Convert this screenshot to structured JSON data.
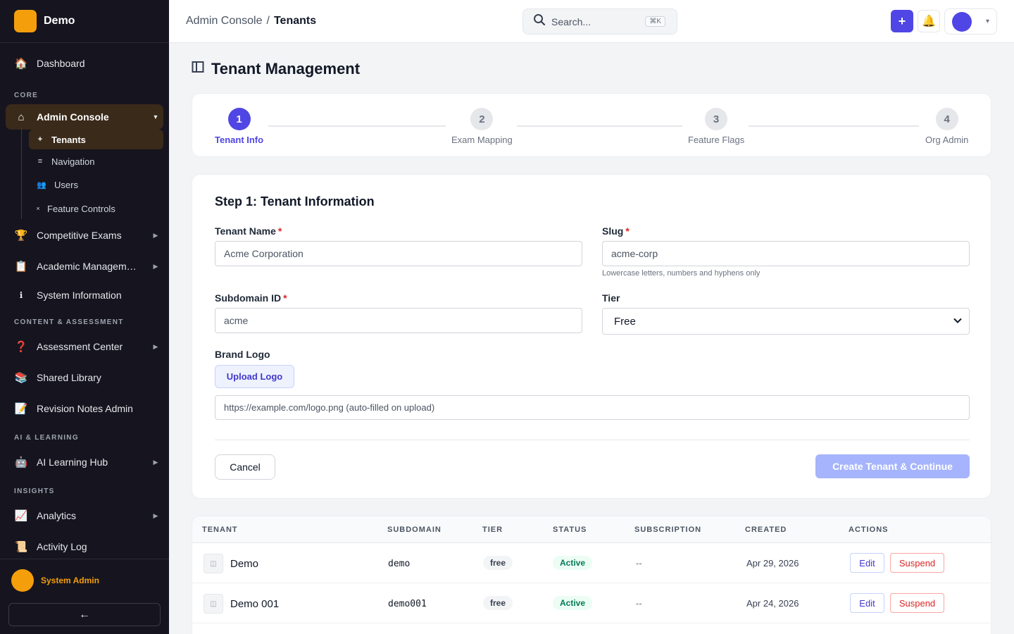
{
  "brand": {
    "name": "Demo"
  },
  "sidebar": {
    "items": [
      {
        "icon": "house-icon",
        "glyph": "🏠",
        "label": "Dashboard"
      },
      {
        "section": "CORE"
      },
      {
        "icon": "home-outline-icon",
        "glyph": "⌂",
        "label": "Admin Console",
        "active": true
      },
      {
        "icon": "trophy-icon",
        "glyph": "🏆",
        "label": "Competitive Exams"
      },
      {
        "icon": "clipboard-icon",
        "glyph": "📋",
        "label": "Academic Managem…"
      },
      {
        "icon": "info-icon",
        "glyph": "ℹ",
        "label": "System Information"
      },
      {
        "section": "CONTENT & ASSESSMENT"
      },
      {
        "icon": "question-icon",
        "glyph": "❓",
        "label": "Assessment Center"
      },
      {
        "icon": "books-icon",
        "glyph": "📚",
        "label": "Shared Library"
      },
      {
        "icon": "memo-icon",
        "glyph": "📝",
        "label": "Revision Notes Admin"
      },
      {
        "section": "AI & LEARNING"
      },
      {
        "icon": "robot-icon",
        "glyph": "🤖",
        "label": "AI Learning Hub"
      },
      {
        "section": "INSIGHTS"
      },
      {
        "icon": "chart-icon",
        "glyph": "📈",
        "label": "Analytics"
      },
      {
        "icon": "scroll-icon",
        "glyph": "📜",
        "label": "Activity Log"
      }
    ],
    "sections": {
      "core": "CORE",
      "content": "CONTENT & ASSESSMENT",
      "ai": "AI & LEARNING",
      "insights": "INSIGHTS"
    },
    "nav": {
      "dashboard": "Dashboard",
      "admin_console": "Admin Console",
      "competitive_exams": "Competitive Exams",
      "academic": "Academic Managem…",
      "system_info": "System Information",
      "assessment": "Assessment Center",
      "shared_library": "Shared Library",
      "revision_notes": "Revision Notes Admin",
      "ai_hub": "AI Learning Hub",
      "analytics": "Analytics",
      "activity_log": "Activity Log"
    },
    "sub": {
      "tenants": "Tenants",
      "navigation": "Navigation",
      "users": "Users",
      "feature_controls": "Feature Controls"
    },
    "user": {
      "name": "System Admin"
    },
    "collapse_glyph": "←"
  },
  "header": {
    "breadcrumb": {
      "parent": "Admin Console",
      "separator": "/",
      "current": "Tenants"
    },
    "search": {
      "placeholder": "Search...",
      "shortcut": "⌘K"
    },
    "add_glyph": "+",
    "bell_glyph": "🔔",
    "profile_caret": "▾"
  },
  "page": {
    "title": "Tenant Management"
  },
  "stepper": {
    "steps": [
      {
        "number": "1",
        "label": "Tenant Info"
      },
      {
        "number": "2",
        "label": "Exam Mapping"
      },
      {
        "number": "3",
        "label": "Feature Flags"
      },
      {
        "number": "4",
        "label": "Org Admin"
      }
    ],
    "active_step": 1
  },
  "form": {
    "title": "Step 1: Tenant Information",
    "tenant_name": {
      "label": "Tenant Name",
      "value": "Acme Corporation"
    },
    "slug": {
      "label": "Slug",
      "value": "acme-corp",
      "hint": "Lowercase letters, numbers and hyphens only"
    },
    "subdomain": {
      "label": "Subdomain ID",
      "value": "acme"
    },
    "tier": {
      "label": "Tier",
      "value": "Free"
    },
    "brand_logo": {
      "label": "Brand Logo",
      "upload_label": "Upload Logo",
      "url_placeholder": "https://example.com/logo.png (auto-filled on upload)"
    },
    "required_mark": "*",
    "cancel_label": "Cancel",
    "submit_label": "Create Tenant & Continue"
  },
  "table": {
    "columns": [
      "TENANT",
      "SUBDOMAIN",
      "TIER",
      "STATUS",
      "SUBSCRIPTION",
      "CREATED",
      "ACTIONS"
    ],
    "rows": [
      {
        "name": "Demo",
        "subdomain": "demo",
        "tier": "free",
        "status": "Active",
        "subscription": "--",
        "created": "Apr 29, 2026"
      },
      {
        "name": "Demo 001",
        "subdomain": "demo001",
        "tier": "free",
        "status": "Active",
        "subscription": "--",
        "created": "Apr 24, 2026"
      }
    ],
    "edit_label": "Edit",
    "suspend_label": "Suspend"
  }
}
